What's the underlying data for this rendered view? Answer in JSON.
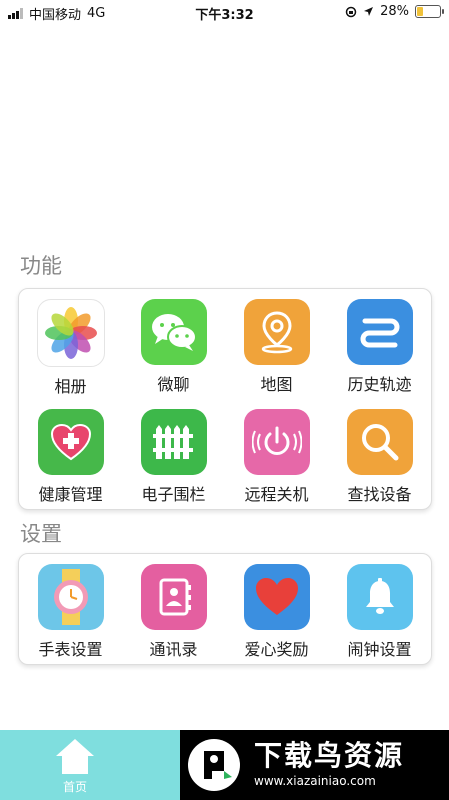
{
  "status_bar": {
    "carrier": "中国移动",
    "network": "4G",
    "time": "下午3:32",
    "battery_percent": "28%",
    "battery_level": 0.28
  },
  "sections": {
    "functions": {
      "title": "功能",
      "items": [
        {
          "label": "相册",
          "icon": "photos-icon"
        },
        {
          "label": "微聊",
          "icon": "chat-icon"
        },
        {
          "label": "地图",
          "icon": "map-pin-icon"
        },
        {
          "label": "历史轨迹",
          "icon": "track-history-icon"
        },
        {
          "label": "健康管理",
          "icon": "health-heart-icon"
        },
        {
          "label": "电子围栏",
          "icon": "fence-icon"
        },
        {
          "label": "远程关机",
          "icon": "power-icon"
        },
        {
          "label": "查找设备",
          "icon": "search-icon"
        }
      ]
    },
    "settings": {
      "title": "设置",
      "items": [
        {
          "label": "手表设置",
          "icon": "watch-icon"
        },
        {
          "label": "通讯录",
          "icon": "contacts-icon"
        },
        {
          "label": "爱心奖励",
          "icon": "heart-reward-icon"
        },
        {
          "label": "闹钟设置",
          "icon": "alarm-bell-icon"
        }
      ]
    }
  },
  "tab_bar": {
    "home_label": "首页"
  },
  "watermark": {
    "title": "下载鸟资源",
    "url": "www.xiazainiao.com"
  },
  "colors": {
    "tab_bar": "#7fdede",
    "chat": "#5cd14c",
    "map": "#f0a33a",
    "track": "#3b8fe0",
    "health": "#46b84a",
    "fence": "#3db84a",
    "power": "#e668a8",
    "search": "#f0a33a",
    "watch": "#6dc6e8",
    "contacts": "#e45fa0",
    "heart_reward": "#3b8fe0",
    "alarm": "#5ec3ee"
  }
}
